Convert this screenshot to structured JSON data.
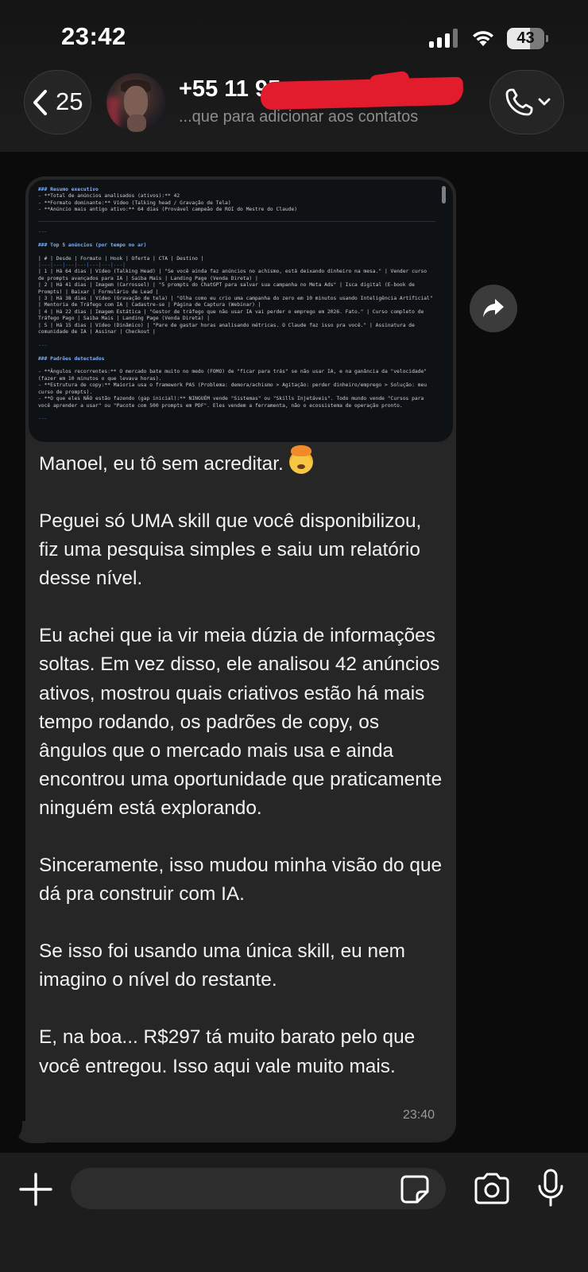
{
  "status_bar": {
    "time": "23:42",
    "battery": "43",
    "battery_level": 0.43
  },
  "header": {
    "back_count": "25",
    "contact_name": "+55 11 95",
    "contact_subtitle": "...que para adicionar aos contatos"
  },
  "doc_preview": {
    "lines": [
      {
        "t": "### Resumo executivo",
        "k": "h"
      },
      {
        "t": "- **Total de anúncios analisados (ativos):** 42",
        "k": ""
      },
      {
        "t": "- **Formato dominante:** Vídeo (Talking head / Gravação de Tela)",
        "k": ""
      },
      {
        "t": "- **Anúncio mais antigo ativo:** 64 dias (Provável campeão de ROI do Mestre do Claude)",
        "k": ""
      },
      {
        "t": "",
        "k": ""
      },
      {
        "t": "",
        "k": "sep"
      },
      {
        "t": "---",
        "k": "rule"
      },
      {
        "t": "",
        "k": ""
      },
      {
        "t": "### Top 5 anúncios (por tempo no ar)",
        "k": "h"
      },
      {
        "t": "",
        "k": ""
      },
      {
        "t": "| # | Desde | Formato | Hook | Oferta | CTA | Destino |",
        "k": ""
      },
      {
        "t": "|---|---|---|---|---|---|---|",
        "k": "rule"
      },
      {
        "t": "| 1 | Há 64 dias | Vídeo (Talking Head) | \"Se você ainda faz anúncios no achismo, está deixando dinheiro na mesa.\" | Vender curso de prompts avançados para IA | Saiba Mais | Landing Page (Venda Direta) |",
        "k": ""
      },
      {
        "t": "| 2 | Há 41 dias | Imagem (Carrossel) | \"5 prompts do ChatGPT para salvar sua campanha no Meta Ads\" | Isca digital (E-book de Prompts) | Baixar | Formulário de Lead |",
        "k": ""
      },
      {
        "t": "| 3 | Há 38 dias | Vídeo (Gravação de tela) | \"Olha como eu crio uma campanha do zero em 10 minutos usando Inteligência Artificial\" | Mentoria de Tráfego com IA | Cadastre-se | Página de Captura (Webinar) |",
        "k": ""
      },
      {
        "t": "| 4 | Há 22 dias | Imagem Estática | \"Gestor de tráfego que não usar IA vai perder o emprego em 2026. Fato.\" | Curso completo de Tráfego Pago | Saiba Mais | Landing Page (Venda Direta) |",
        "k": ""
      },
      {
        "t": "| 5 | Há 15 dias | Vídeo (Dinâmico) | \"Pare de gastar horas analisando métricas. O Claude faz isso pra você.\" | Assinatura de comunidade de IA | Assinar | Checkout |",
        "k": ""
      },
      {
        "t": "",
        "k": ""
      },
      {
        "t": "---",
        "k": "rule"
      },
      {
        "t": "",
        "k": ""
      },
      {
        "t": "### Padrões detectados",
        "k": "h"
      },
      {
        "t": "",
        "k": ""
      },
      {
        "t": "- **Ângulos recorrentes:** O mercado bate muito no medo (FOMO) de \"ficar para trás\" se não usar IA, e na ganância da \"velocidade\" (fazer em 10 minutos o que levava horas).",
        "k": ""
      },
      {
        "t": "- **Estrutura de copy:** Maioria usa o framework PAS (Problema: demora/achismo > Agitação: perder dinheiro/emprego > Solução: meu curso de prompts).",
        "k": ""
      },
      {
        "t": "- **O que eles NÃO estão fazendo (gap inicial):** NINGUÉM vende \"Sistemas\" ou \"Skills Injetáveis\". Todo mundo vende \"Cursos para você aprender a usar\" ou \"Pacote com 500 prompts em PDF\". Eles vendem a ferramenta, não o ecossistema de operação pronto.",
        "k": ""
      },
      {
        "t": "",
        "k": ""
      },
      {
        "t": "---",
        "k": "rule"
      }
    ]
  },
  "message": {
    "paragraphs": [
      "Manoel, eu tô sem acreditar.",
      "Peguei só UMA skill que você disponibilizou, fiz uma pesquisa simples e saiu um relatório desse nível.",
      "Eu achei que ia vir meia dúzia de informações soltas. Em vez disso, ele analisou 42 anúncios ativos, mostrou quais criativos estão há mais tempo rodando, os padrões de copy, os ângulos que o mercado mais usa e ainda encontrou uma oportunidade que praticamente ninguém está explorando.",
      "Sinceramente, isso mudou minha visão do que dá pra construir com IA.",
      "Se isso foi usando uma única skill, eu nem imagino o nível do restante.",
      "E, na boa... R$297 tá muito barato pelo que você entregou. Isso aqui vale muito mais."
    ],
    "emoji": "exploding-head-emoji",
    "time": "23:40"
  },
  "composer": {
    "value": ""
  },
  "icons": {
    "back": "chevron-left-icon",
    "call": "phone-icon",
    "forward": "forward-arrow-icon",
    "plus": "plus-icon",
    "sticker": "sticker-icon",
    "camera": "camera-icon",
    "mic": "microphone-icon"
  },
  "colors": {
    "bubble": "#262626",
    "background": "#0b0b0b",
    "redaction": "#e21b2d"
  }
}
